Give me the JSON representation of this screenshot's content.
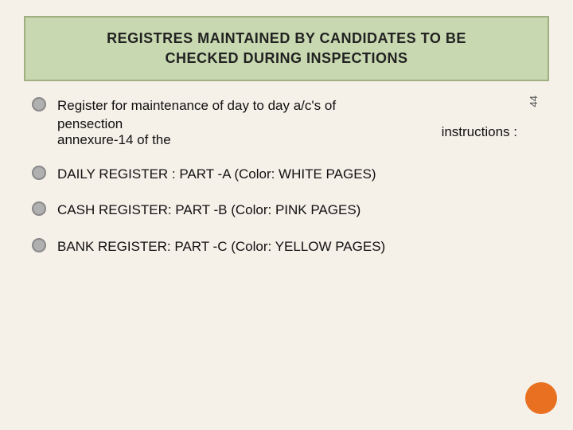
{
  "header": {
    "line1": "REGISTRES MAINTAINED BY CANDIDATES TO BE",
    "line2": "CHECKED DURING INSPECTIONS"
  },
  "section1": {
    "bullet_color": "#b0b0b0",
    "line1": "Register    for  maintenance  of  day  to  day  a/c's  of",
    "line2_left": "pensection",
    "line2_sub": "annexure-14 of the",
    "line2_right": "instructions :",
    "page_number": "44"
  },
  "section2": {
    "text": "DAILY    REGISTER :     PART    -A   (Color:    WHITE PAGES)"
  },
  "section3": {
    "text": "CASH   REGISTER:  PART  -B  (Color:  PINK  PAGES)"
  },
  "section4": {
    "text": "BANK  REGISTER: PART -C (Color: YELLOW  PAGES)"
  }
}
